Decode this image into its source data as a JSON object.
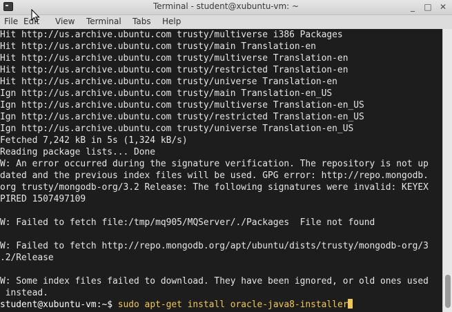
{
  "window": {
    "title": "Terminal - student@xubuntu-vm: ~",
    "controls": {
      "minimize": "_",
      "maximize": "□",
      "close": "✕"
    }
  },
  "menu": [
    {
      "label": "File"
    },
    {
      "label": "Edit"
    },
    {
      "label": "View"
    },
    {
      "label": "Terminal"
    },
    {
      "label": "Tabs"
    },
    {
      "label": "Help"
    }
  ],
  "terminal": {
    "lines": [
      "Hit http://us.archive.ubuntu.com trusty/multiverse i386 Packages",
      "Hit http://us.archive.ubuntu.com trusty/main Translation-en",
      "Hit http://us.archive.ubuntu.com trusty/multiverse Translation-en",
      "Hit http://us.archive.ubuntu.com trusty/restricted Translation-en",
      "Hit http://us.archive.ubuntu.com trusty/universe Translation-en",
      "Ign http://us.archive.ubuntu.com trusty/main Translation-en_US",
      "Ign http://us.archive.ubuntu.com trusty/multiverse Translation-en_US",
      "Ign http://us.archive.ubuntu.com trusty/restricted Translation-en_US",
      "Ign http://us.archive.ubuntu.com trusty/universe Translation-en_US",
      "Fetched 7,242 kB in 5s (1,324 kB/s)",
      "Reading package lists... Done",
      "W: An error occurred during the signature verification. The repository is not up",
      "dated and the previous index files will be used. GPG error: http://repo.mongodb.",
      "org trusty/mongodb-org/3.2 Release: The following signatures were invalid: KEYEX",
      "PIRED 1507497109",
      "",
      "W: Failed to fetch file:/tmp/mq905/MQServer/./Packages  File not found",
      "",
      "W: Failed to fetch http://repo.mongodb.org/apt/ubuntu/dists/trusty/mongodb-org/3",
      ".2/Release",
      "",
      "W: Some index files failed to download. They have been ignored, or old ones used",
      " instead."
    ],
    "prompt": "student@xubuntu-vm:~$ ",
    "command": "sudo apt-get install oracle-java8-installer"
  }
}
